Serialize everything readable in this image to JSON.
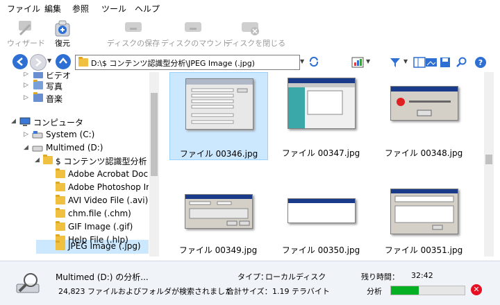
{
  "menu": [
    "ファイル",
    "編集",
    "参照",
    "ツール",
    "ヘルプ"
  ],
  "toolbar": {
    "wizard": "ウィザード",
    "restore": "復元",
    "save_disk": "ディスクの保存",
    "mount_disk": "ディスクのマウント",
    "close_disk": "ディスクを閉じる"
  },
  "address": {
    "path": "D:\\$ コンテンツ認識型分析\\JPEG Image (.jpg)"
  },
  "tree": {
    "video": "ビデオ",
    "photos": "写真",
    "music": "音楽",
    "computer": "コンピュータ",
    "system_drive": "System (C:)",
    "multimed_drive": "Multimed (D:)",
    "content_analysis": "$ コンテンツ認識型分析",
    "folders": [
      "Adobe Acrobat Documer",
      "Adobe Photoshop Image",
      "AVI Video File (.avi)",
      "chm.file (.chm)",
      "GIF Image (.gif)",
      "Help File (.hlp)",
      "JPEG Image (.jpg)"
    ]
  },
  "files": [
    "ファイル 00346.jpg",
    "ファイル 00347.jpg",
    "ファイル 00348.jpg",
    "ファイル 00349.jpg",
    "ファイル 00350.jpg",
    "ファイル 00351.jpg"
  ],
  "status": {
    "analyzing": "Multimed (D:) の分析...",
    "found": "24,823 ファイルおよびフォルダが検索されました",
    "type_label": "タイプ：",
    "type_value": "ローカルディスク",
    "size_label": "合計サイズ：",
    "size_value": "1.19 テラバイト",
    "remaining_label": "残り時間：",
    "remaining_value": "32:42",
    "analysis_label": "分析",
    "progress": 0.38
  },
  "colors": {
    "accent": "#cce8ff",
    "progress": "#06b025",
    "cancel": "#e81123"
  }
}
